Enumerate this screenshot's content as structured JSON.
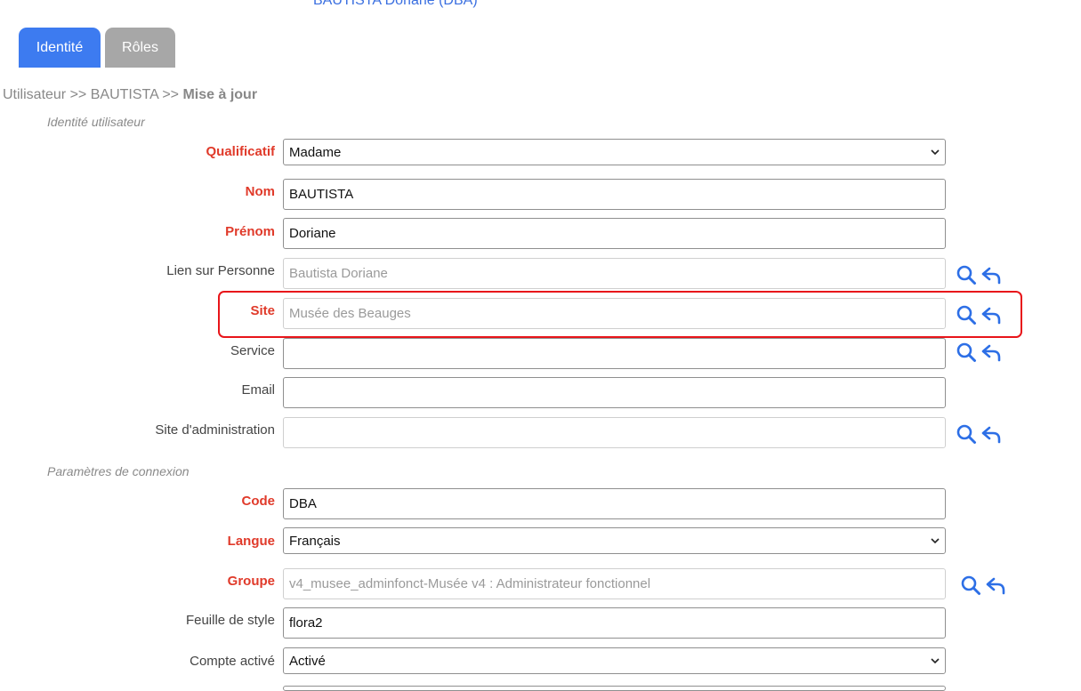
{
  "header": {
    "user_title": "BAUTISTA Doriane (DBA)"
  },
  "tabs": [
    {
      "label": "Identité",
      "active": true
    },
    {
      "label": "Rôles",
      "active": false
    }
  ],
  "breadcrumb": {
    "part1": "Utilisateur",
    "sep1": " >> ",
    "part2": "BAUTISTA",
    "sep2": " >> ",
    "current": "Mise à jour"
  },
  "sections": {
    "identity": "Identité utilisateur",
    "connection": "Paramètres de connexion"
  },
  "fields": {
    "qualificatif": {
      "label": "Qualificatif",
      "value": "Madame",
      "required": true
    },
    "nom": {
      "label": "Nom",
      "value": "BAUTISTA",
      "required": true
    },
    "prenom": {
      "label": "Prénom",
      "value": "Doriane",
      "required": true
    },
    "lien_personne": {
      "label": "Lien sur Personne",
      "value": "Bautista Doriane"
    },
    "site": {
      "label": "Site",
      "value": "Musée des Beauges",
      "required": true
    },
    "service": {
      "label": "Service",
      "value": ""
    },
    "email": {
      "label": "Email",
      "value": ""
    },
    "site_admin": {
      "label": "Site d'administration",
      "value": ""
    },
    "code": {
      "label": "Code",
      "value": "DBA",
      "required": true
    },
    "langue": {
      "label": "Langue",
      "value": "Français",
      "required": true
    },
    "groupe": {
      "label": "Groupe",
      "value": "v4_musee_adminfonct-Musée v4 : Administrateur fonctionnel",
      "required": true
    },
    "feuille_style": {
      "label": "Feuille de style",
      "value": "flora2"
    },
    "compte_active": {
      "label": "Compte activé",
      "value": "Activé"
    }
  },
  "icons": {
    "search": "search-icon",
    "reset": "reply-icon"
  },
  "colors": {
    "accent": "#3d7bf0",
    "required_label": "#e03a2a",
    "highlight": "#e8151a",
    "tab_inactive": "#a7a7a7"
  }
}
